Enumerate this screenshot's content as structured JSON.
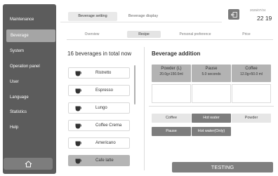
{
  "sidebar": {
    "items": [
      {
        "label": "Maintenance"
      },
      {
        "label": "Beverage"
      },
      {
        "label": "System"
      },
      {
        "label": "Operation panel"
      },
      {
        "label": "User"
      },
      {
        "label": "Language"
      },
      {
        "label": "Statistics"
      },
      {
        "label": "Help"
      }
    ],
    "active_index": 1,
    "home_icon": "home-icon"
  },
  "header": {
    "tabs": [
      {
        "label": "Beverage setting"
      },
      {
        "label": "Beverage display"
      }
    ],
    "back_icon": "exit-icon",
    "date": "2025/07/24",
    "time": "22 19"
  },
  "subtabs": [
    {
      "label": "Overview"
    },
    {
      "label": "Recipe"
    },
    {
      "label": "Personal preference"
    },
    {
      "label": "Price"
    }
  ],
  "beverage_list": {
    "title": "16 beverages in total now",
    "items": [
      {
        "label": "Ristretto"
      },
      {
        "label": "Espresso"
      },
      {
        "label": "Lungo"
      },
      {
        "label": "Coffee Crema"
      },
      {
        "label": "Americano"
      },
      {
        "label": "Cafe latte"
      }
    ],
    "selected_index": 5
  },
  "addition": {
    "title": "Beverage addition",
    "params": [
      {
        "name": "Powder (L)",
        "value": "20.0g+150.0ml"
      },
      {
        "name": "Pause",
        "value": "5.0 seconds"
      },
      {
        "name": "Coffee",
        "value": "12.0g+50.0 ml"
      }
    ],
    "options": [
      {
        "label": "Coffee"
      },
      {
        "label": "Hot water"
      },
      {
        "label": "Powder"
      },
      {
        "label": "Pause"
      },
      {
        "label": "Hot water(Only)"
      }
    ]
  },
  "testing_label": "TESTING",
  "colors": {
    "sidebar_bg": "#5c5c5c",
    "active_nav": "#a5a5a5",
    "param_bg": "#b3b3b3",
    "dark_option": "#7d7d7d",
    "testing_bg": "#7f7f7f"
  }
}
